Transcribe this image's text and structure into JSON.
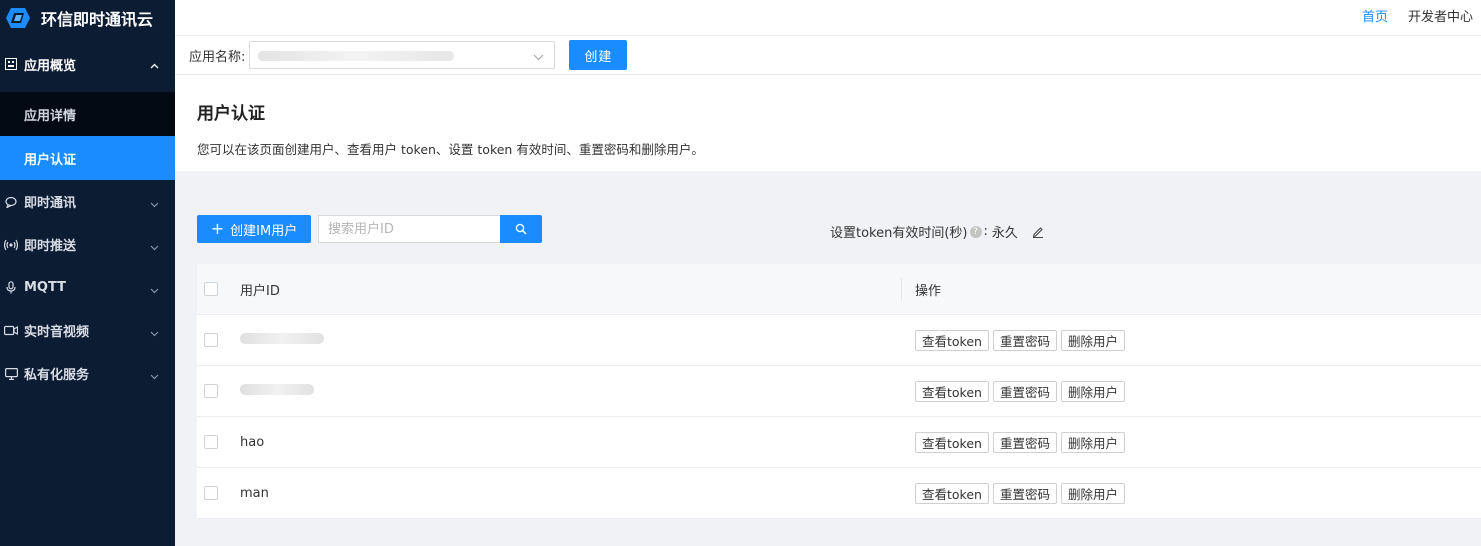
{
  "brand": {
    "name": "环信即时通讯云"
  },
  "topbar": {
    "home": "首页",
    "developer_center": "开发者中心"
  },
  "sidebar": {
    "group": {
      "label": "应用概览",
      "expanded": true
    },
    "sub_items": [
      {
        "label": "应用详情",
        "active": false
      },
      {
        "label": "用户认证",
        "active": true
      }
    ],
    "items": [
      {
        "label": "即时通讯",
        "icon": "chat-icon"
      },
      {
        "label": "即时推送",
        "icon": "broadcast-icon"
      },
      {
        "label": "MQTT",
        "icon": "mic-icon"
      },
      {
        "label": "实时音视频",
        "icon": "video-icon"
      },
      {
        "label": "私有化服务",
        "icon": "monitor-icon"
      }
    ]
  },
  "appbar": {
    "label": "应用名称:",
    "create_button": "创建"
  },
  "page": {
    "title": "用户认证",
    "description": "您可以在该页面创建用户、查看用户 token、设置 token 有效时间、重置密码和删除用户。"
  },
  "toolbar": {
    "add_user_label": "创建IM用户",
    "search_placeholder": "搜索用户ID",
    "token_label": "设置token有效时间(秒)",
    "token_colon": ":",
    "token_value": "永久"
  },
  "table": {
    "headers": {
      "user_id": "用户ID",
      "actions": "操作"
    },
    "rows": [
      {
        "user_id": "",
        "masked": true
      },
      {
        "user_id": "",
        "masked": true
      },
      {
        "user_id": "hao",
        "masked": false
      },
      {
        "user_id": "man",
        "masked": false
      }
    ],
    "actions": {
      "view_token": "查看token",
      "reset_password": "重置密码",
      "delete_user": "删除用户"
    }
  },
  "colors": {
    "accent": "#1a8cff",
    "sidebar_bg": "#0b1c33",
    "sub_bg": "#030a14"
  }
}
